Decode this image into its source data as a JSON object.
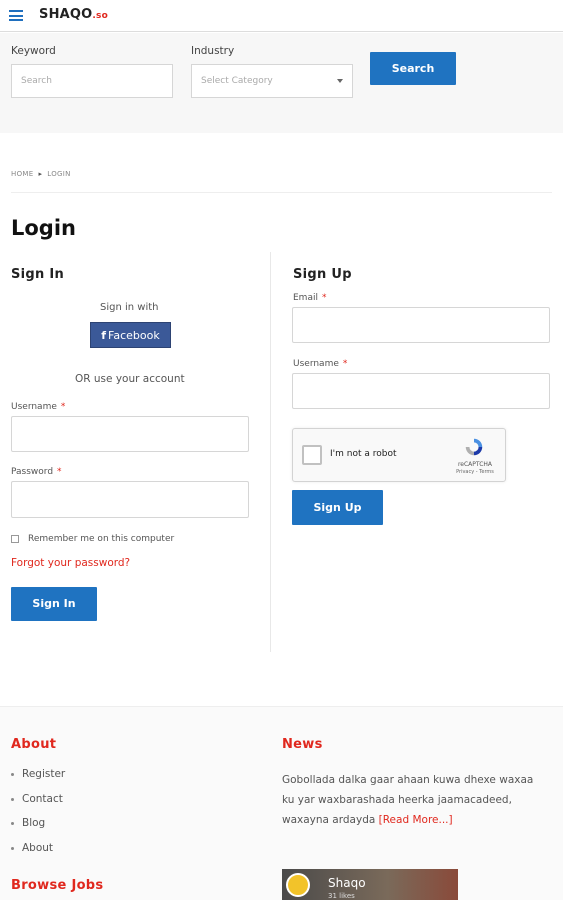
{
  "header": {
    "logo_main": "SHAQO",
    "logo_domain": ".so"
  },
  "search": {
    "keyword_label": "Keyword",
    "keyword_placeholder": "Search",
    "industry_label": "Industry",
    "industry_selected": "Select Category",
    "search_button": "Search"
  },
  "breadcrumb": {
    "home": "HOME",
    "current": "LOGIN"
  },
  "page_title": "Login",
  "signin": {
    "title": "Sign In",
    "signin_with": "Sign in with",
    "facebook_label": "Facebook",
    "or_text": "OR use your account",
    "username_label": "Username",
    "password_label": "Password",
    "required_mark": "*",
    "remember_label": "Remember me on this computer",
    "forgot_link": "Forgot your password?",
    "submit_label": "Sign In"
  },
  "signup": {
    "title": "Sign Up",
    "email_label": "Email",
    "username_label": "Username",
    "required_mark": "*",
    "captcha_text": "I'm not a robot",
    "captcha_brand": "reCAPTCHA",
    "captcha_terms": "Privacy - Terms",
    "submit_label": "Sign Up"
  },
  "footer": {
    "about_title": "About",
    "about_items": [
      "Register",
      "Contact",
      "Blog",
      "About"
    ],
    "browse_title": "Browse Jobs",
    "news_title": "News",
    "news_text": "Gobollada dalka gaar ahaan kuwa dhexe waxaa ku yar waxbarashada heerka jaamacadeed, waxayna ardayda",
    "news_more": "[Read More...]",
    "video_channel": "Shaqo",
    "video_sub": "31 likes"
  },
  "colors": {
    "accent_blue": "#1f73c1",
    "accent_red": "#e0281e",
    "facebook_blue": "#3b5998"
  }
}
